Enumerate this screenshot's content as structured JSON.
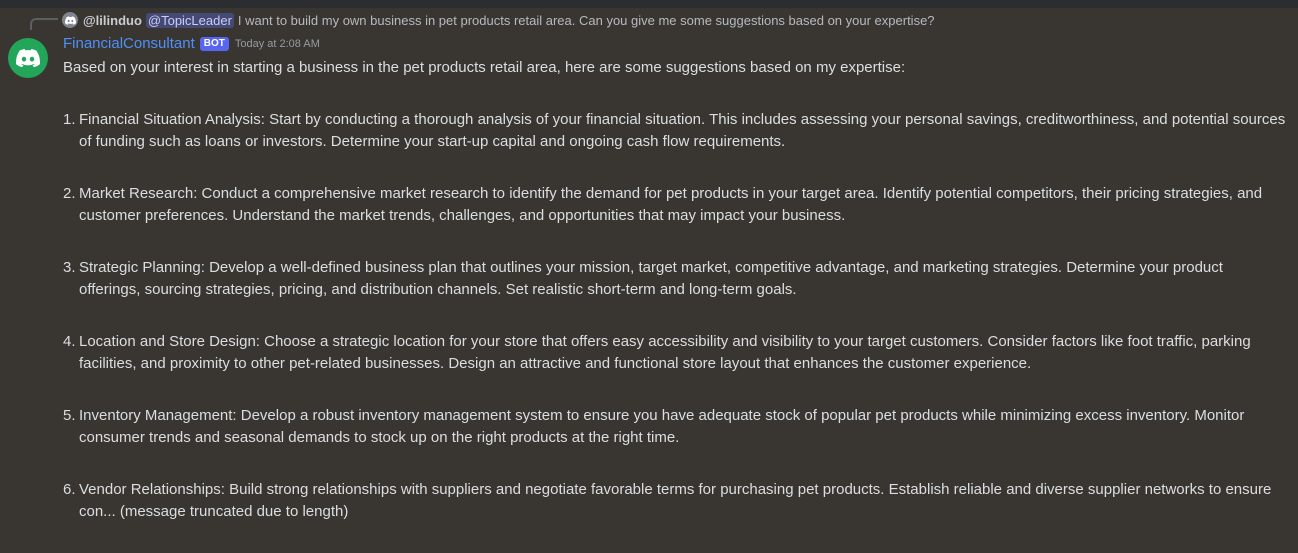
{
  "reply": {
    "username": "@lilinduo",
    "mention": "@TopicLeader",
    "text": "I want to build my own business in pet products retail area. Can you give me some suggestions based on your expertise?"
  },
  "message": {
    "author": "FinancialConsultant",
    "badge": "BOT",
    "timestamp": "Today at 2:08 AM",
    "intro": "Based on your interest in starting a business in the pet products retail area, here are some suggestions based on my expertise:",
    "items": [
      {
        "number": "1.",
        "text": "Financial Situation Analysis: Start by conducting a thorough analysis of your financial situation. This includes assessing your personal savings, creditworthiness, and potential sources of funding such as loans or investors. Determine your start-up capital and ongoing cash flow requirements."
      },
      {
        "number": "2.",
        "text": "Market Research: Conduct a comprehensive market research to identify the demand for pet products in your target area. Identify potential competitors, their pricing strategies, and customer preferences. Understand the market trends, challenges, and opportunities that may impact your business."
      },
      {
        "number": "3.",
        "text": "Strategic Planning: Develop a well-defined business plan that outlines your mission, target market, competitive advantage, and marketing strategies. Determine your product offerings, sourcing strategies, pricing, and distribution channels. Set realistic short-term and long-term goals."
      },
      {
        "number": "4.",
        "text": "Location and Store Design: Choose a strategic location for your store that offers easy accessibility and visibility to your target customers. Consider factors like foot traffic, parking facilities, and proximity to other pet-related businesses. Design an attractive and functional store layout that enhances the customer experience."
      },
      {
        "number": "5.",
        "text": "Inventory Management: Develop a robust inventory management system to ensure you have adequate stock of popular pet products while minimizing excess inventory. Monitor consumer trends and seasonal demands to stock up on the right products at the right time."
      },
      {
        "number": "6.",
        "text": "Vendor Relationships: Build strong relationships with suppliers and negotiate favorable terms for purchasing pet products. Establish reliable and diverse supplier networks to ensure con... (message truncated due to length)"
      }
    ]
  },
  "colors": {
    "background": "#393631",
    "username": "#4f8ff7",
    "bot_badge": "#5865f2",
    "avatar": "#23a55a",
    "text": "#dbdee1"
  },
  "icons": {
    "reply_avatar": "discord-logo-icon",
    "author_avatar": "discord-logo-icon"
  }
}
